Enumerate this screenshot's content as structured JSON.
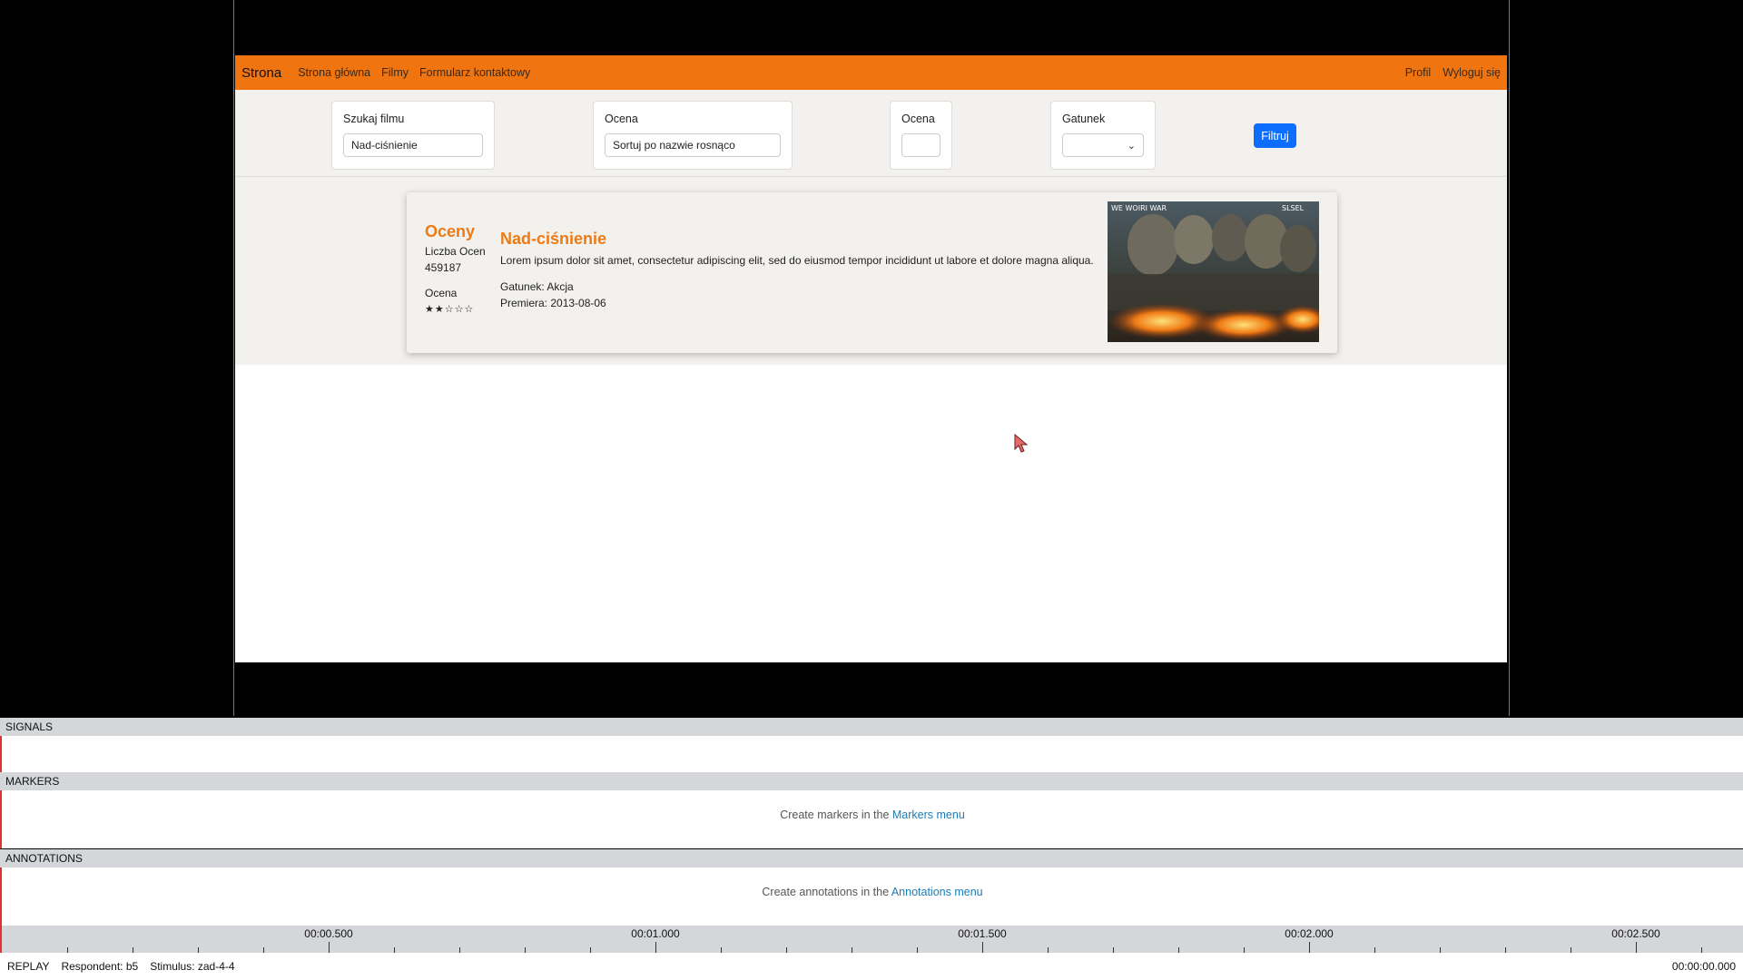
{
  "navbar": {
    "brand": "Strona",
    "links": [
      "Strona główna",
      "Filmy",
      "Formularz kontaktowy"
    ],
    "right_links": [
      "Profil",
      "Wyloguj się"
    ]
  },
  "filters": {
    "search_label": "Szukaj filmu",
    "search_value": "Nad-ciśnienie",
    "sort_label": "Ocena",
    "sort_value": "Sortuj po nazwie rosnąco",
    "rating_label": "Ocena",
    "rating_value": "",
    "genre_label": "Gatunek",
    "genre_value": "",
    "filter_button": "Filtruj"
  },
  "movie": {
    "ratings_title": "Oceny",
    "count_label": "Liczba Ocen",
    "count_value": "459187",
    "rating_label": "Ocena",
    "stars": "★★☆☆☆",
    "title": "Nad-ciśnienie",
    "description": "Lorem ipsum dolor sit amet, consectetur adipiscing elit, sed do eiusmod tempor incididunt ut labore et dolore magna aliqua.",
    "genre": "Gatunek: Akcja",
    "premiere": "Premiera: 2013-08-06",
    "poster_text_left": "WE WOIRI WAR",
    "poster_text_right": "SLSEL"
  },
  "panels": {
    "signals": "SIGNALS",
    "markers": "MARKERS",
    "markers_msg": "Create markers in the ",
    "markers_link": "Markers menu",
    "annotations": "ANNOTATIONS",
    "annotations_msg": "Create annotations in the ",
    "annotations_link": "Annotations menu"
  },
  "timeline": {
    "labels": [
      "00:00.500",
      "00:01.000",
      "00:01.500",
      "00:02.000",
      "00:02.500"
    ]
  },
  "status": {
    "mode": "REPLAY",
    "respondent": "Respondent: b5",
    "stimulus": "Stimulus: zad-4-4",
    "time": "00:00:00.000"
  }
}
